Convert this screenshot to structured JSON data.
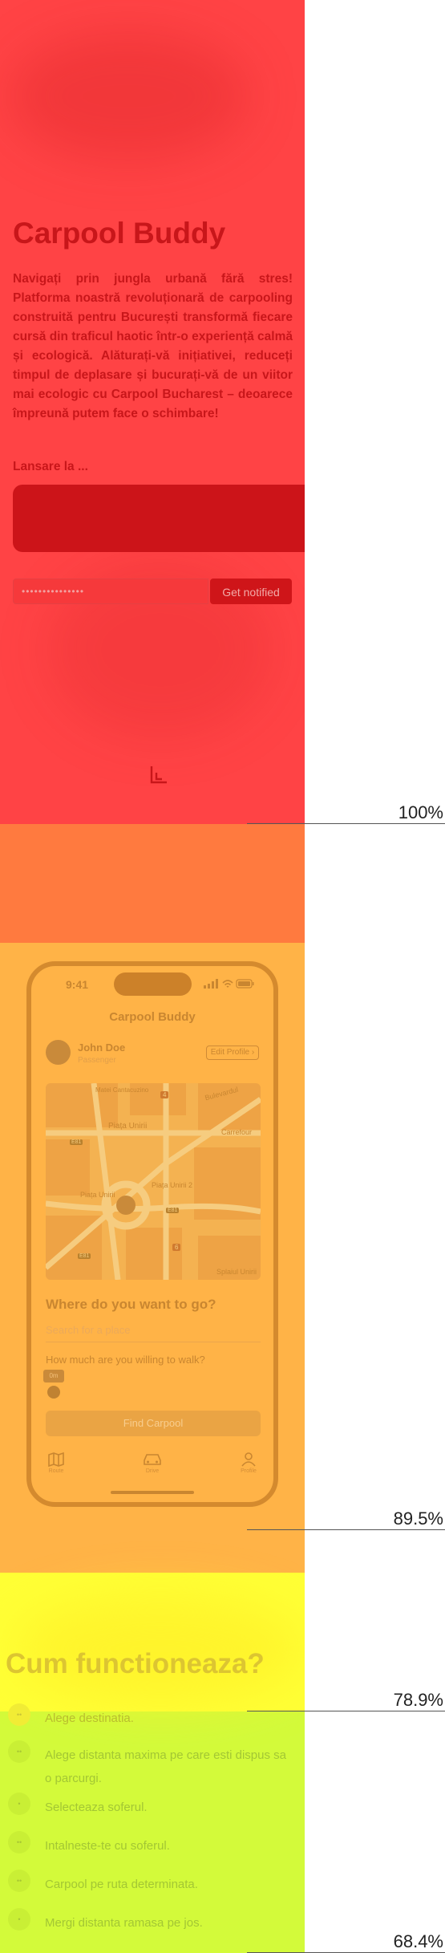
{
  "hero": {
    "title": "Carpool Buddy",
    "description": "Navigați prin jungla urbană fără stres! Platforma noastră revoluționară de carpooling construită pentru București transformă fiecare cursă din traficul haotic într-o experiență calmă și ecologică. Alăturați-vă inițiativei, reduceți timpul de deplasare și bucurați-vă de un viitor mai ecologic cu Carpool Bucharest – deoarece împreună putem face o schimbare!",
    "launch_label": "Lansare la ...",
    "email_value": "•••••••••••••••",
    "notify_label": "Get notified",
    "scroll_icon": "mouse-scroll-icon"
  },
  "phone": {
    "time": "9:41",
    "app_title": "Carpool Buddy",
    "user_name": "John Doe",
    "user_role": "Passenger",
    "edit_profile": "Edit Profile",
    "map_labels": {
      "l1": "Matei Cantacuzino",
      "l2": "Bulevardul",
      "l3": "Piața Unirii",
      "l4": "Piața Unirii 2",
      "l5": "Piața Unirii",
      "l6": "Carrefour",
      "l7": "Splaiul Unirii",
      "b1": "4",
      "b2": "6",
      "b3": "E81",
      "b4": "E81",
      "b5": "E81"
    },
    "where_title": "Where do you want to go?",
    "search_placeholder": "Search for a place",
    "walk_question": "How much are you willing to walk?",
    "walk_value": "0m",
    "find_button": "Find Carpool",
    "tabs": [
      {
        "label": "Route",
        "icon": "map-icon"
      },
      {
        "label": "Drive",
        "icon": "car-icon"
      },
      {
        "label": "Profile",
        "icon": "profile-icon"
      }
    ]
  },
  "how": {
    "title": "Cum functioneaza?",
    "steps": [
      {
        "label": "Alege destinatia.",
        "badge": "••"
      },
      {
        "label": "Alege distanta maxima pe care esti dispus sa o parcurgi.",
        "badge": "••"
      },
      {
        "label": "Selecteaza soferul.",
        "badge": "•"
      },
      {
        "label": "Intalneste-te cu soferul.",
        "badge": "••"
      },
      {
        "label": "Carpool pe ruta determinata.",
        "badge": "••"
      },
      {
        "label": "Mergi distanta ramasa pe jos.",
        "badge": "•"
      }
    ]
  },
  "indicators": [
    {
      "label": "100%"
    },
    {
      "label": "89.5%"
    },
    {
      "label": "78.9%"
    },
    {
      "label": "68.4%"
    }
  ],
  "colors": {
    "band_red": "#ff4345",
    "band_orange": "#ff7a3f",
    "band_amber": "#ffb347",
    "band_yellow": "#ffff35",
    "band_lime": "#d3fa3a"
  }
}
